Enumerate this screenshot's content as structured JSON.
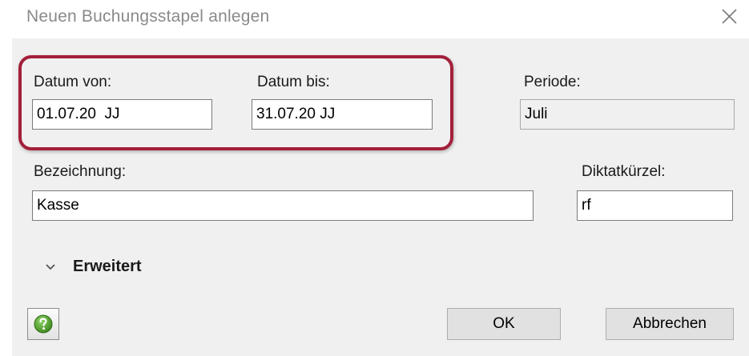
{
  "window": {
    "title": "Neuen Buchungsstapel anlegen",
    "close_icon": "close-icon"
  },
  "form": {
    "datum_von": {
      "label": "Datum von:",
      "value": "01.07.20  JJ"
    },
    "datum_bis": {
      "label": "Datum bis:",
      "value": "31.07.20 JJ"
    },
    "periode": {
      "label": "Periode:",
      "value": "Juli"
    },
    "bezeichnung": {
      "label": "Bezeichnung:",
      "value": "Kasse"
    },
    "diktatkuerzel": {
      "label": "Diktatkürzel:",
      "value": "rf"
    }
  },
  "expander": {
    "label": "Erweitert",
    "icon": "chevron-down-icon"
  },
  "buttons": {
    "help_icon": "help-icon",
    "ok": "OK",
    "cancel": "Abbrechen"
  },
  "colors": {
    "highlight": "#a3203a",
    "dialog_background": "#f0f0f0",
    "help_green": "#4c9a2a"
  }
}
